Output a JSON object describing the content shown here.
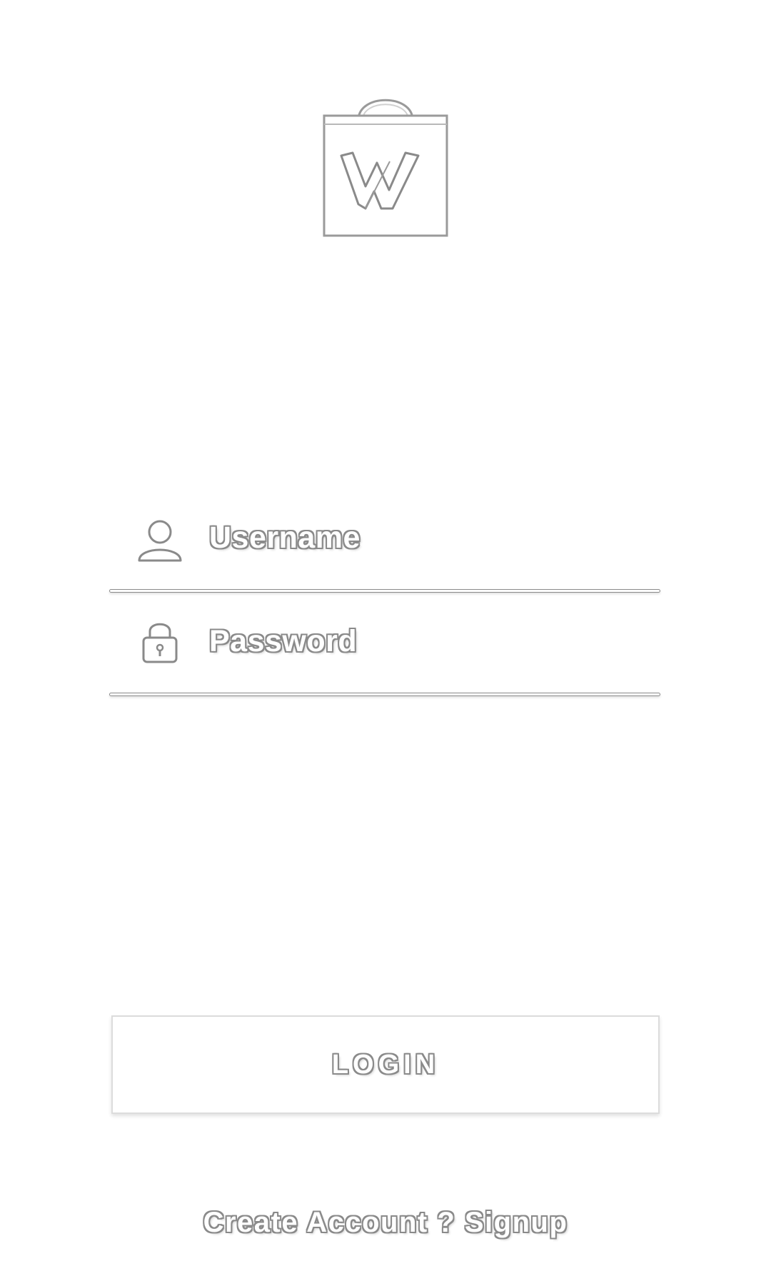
{
  "app": {
    "logo_icon": "shopping-bag-w-logo-icon"
  },
  "form": {
    "username": {
      "placeholder": "Username",
      "value": "",
      "icon": "user-icon"
    },
    "password": {
      "placeholder": "Password",
      "value": "",
      "icon": "lock-icon"
    }
  },
  "actions": {
    "login_label": "LOGIN",
    "signup_label": "Create Account ? Signup"
  },
  "colors": {
    "background": "#ffffff",
    "outline": "#8a8a8a"
  }
}
